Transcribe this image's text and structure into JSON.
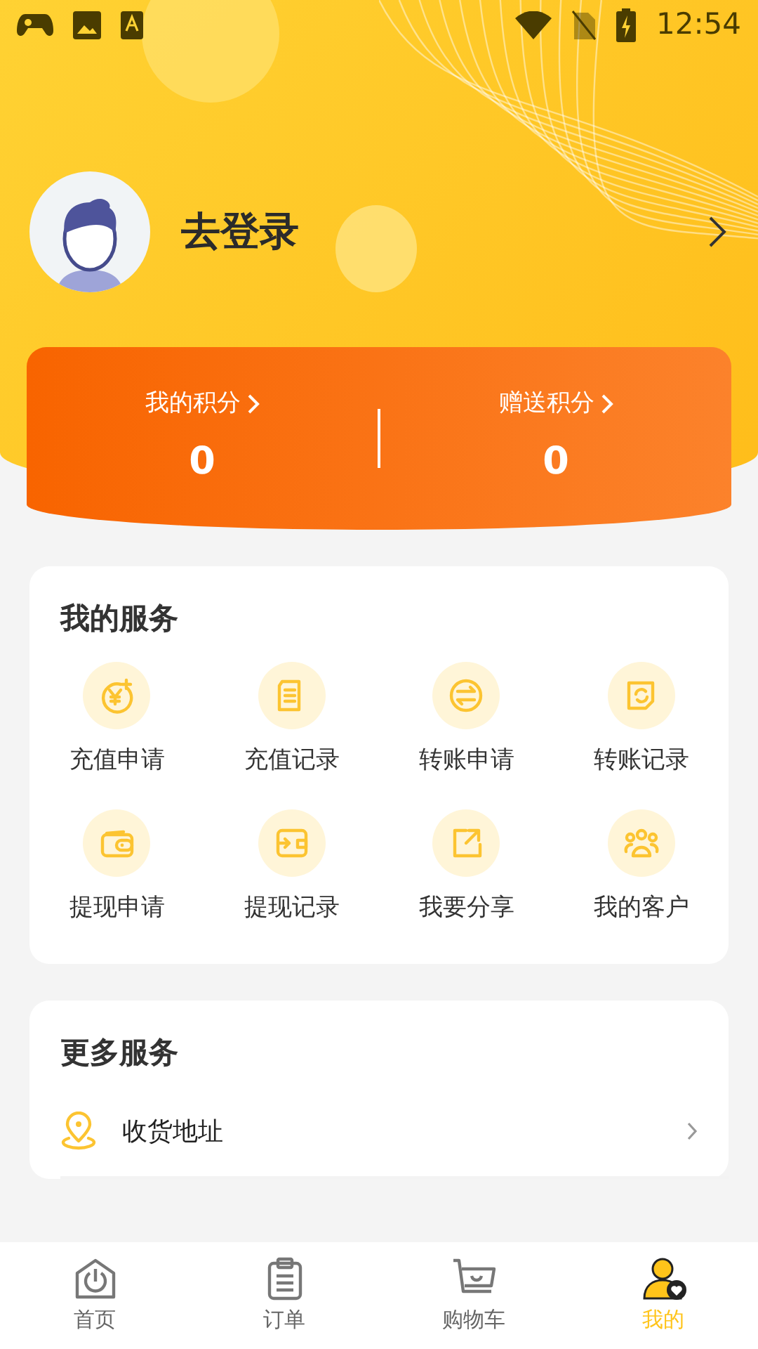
{
  "status_bar": {
    "time": "12:54"
  },
  "profile": {
    "name": "去登录"
  },
  "points": [
    {
      "label": "我的积分",
      "value": "0"
    },
    {
      "label": "赠送积分",
      "value": "0"
    }
  ],
  "my_services": {
    "title": "我的服务",
    "items": [
      {
        "label": "充值申请"
      },
      {
        "label": "充值记录"
      },
      {
        "label": "转账申请"
      },
      {
        "label": "转账记录"
      },
      {
        "label": "提现申请"
      },
      {
        "label": "提现记录"
      },
      {
        "label": "我要分享"
      },
      {
        "label": "我的客户"
      }
    ]
  },
  "more_services": {
    "title": "更多服务",
    "items": [
      {
        "label": "收货地址"
      }
    ]
  },
  "tabs": [
    {
      "label": "首页",
      "selected": false
    },
    {
      "label": "订单",
      "selected": false
    },
    {
      "label": "购物车",
      "selected": false
    },
    {
      "label": "我的",
      "selected": true
    }
  ]
}
